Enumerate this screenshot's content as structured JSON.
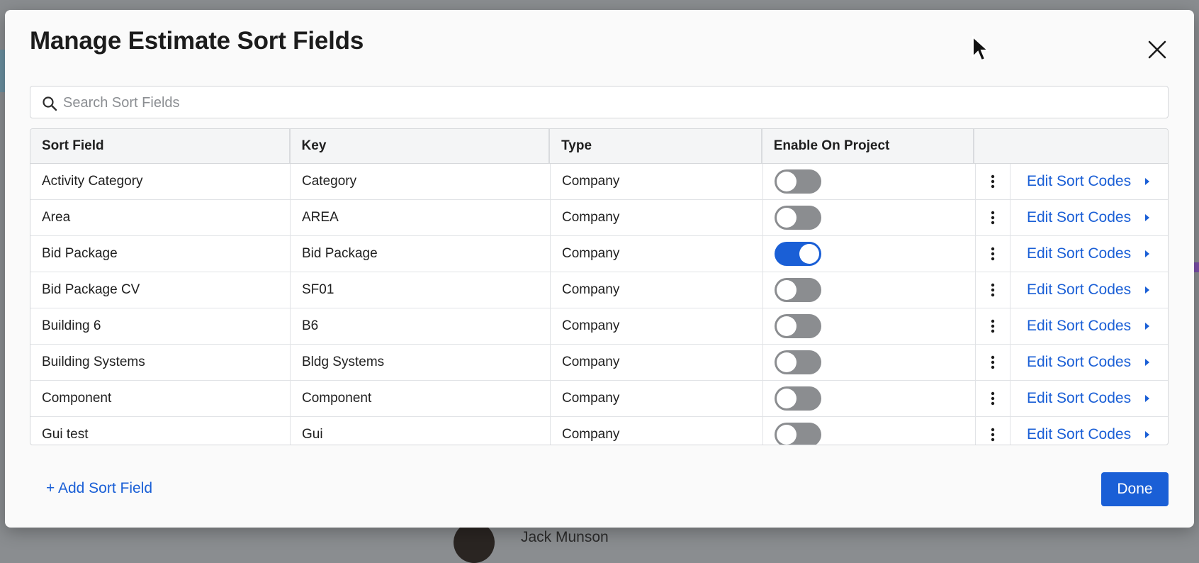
{
  "modal": {
    "title": "Manage Estimate Sort Fields",
    "close_icon": "close-icon"
  },
  "search": {
    "placeholder": "Search Sort Fields",
    "value": "",
    "icon": "search-icon"
  },
  "table": {
    "columns": [
      "Sort Field",
      "Key",
      "Type",
      "Enable On Project",
      ""
    ],
    "rows": [
      {
        "sort_field": "Activity Category",
        "key": "Category",
        "type": "Company",
        "enabled": false,
        "action": "Edit Sort Codes"
      },
      {
        "sort_field": "Area",
        "key": "AREA",
        "type": "Company",
        "enabled": false,
        "action": "Edit Sort Codes"
      },
      {
        "sort_field": "Bid Package",
        "key": "Bid Package",
        "type": "Company",
        "enabled": true,
        "action": "Edit Sort Codes"
      },
      {
        "sort_field": "Bid Package CV",
        "key": "SF01",
        "type": "Company",
        "enabled": false,
        "action": "Edit Sort Codes"
      },
      {
        "sort_field": "Building 6",
        "key": "B6",
        "type": "Company",
        "enabled": false,
        "action": "Edit Sort Codes"
      },
      {
        "sort_field": "Building Systems",
        "key": "Bldg Systems",
        "type": "Company",
        "enabled": false,
        "action": "Edit Sort Codes"
      },
      {
        "sort_field": "Component",
        "key": "Component",
        "type": "Company",
        "enabled": false,
        "action": "Edit Sort Codes"
      },
      {
        "sort_field": "Gui test",
        "key": "Gui",
        "type": "Company",
        "enabled": false,
        "action": "Edit Sort Codes"
      }
    ]
  },
  "footer": {
    "add_label": "+ Add Sort Field",
    "done_label": "Done"
  },
  "background": {
    "user_name": "Jack Munson"
  },
  "colors": {
    "accent": "#1a5fd6",
    "toggle_off": "#8b8d90",
    "overlay": "#8a8d90"
  }
}
